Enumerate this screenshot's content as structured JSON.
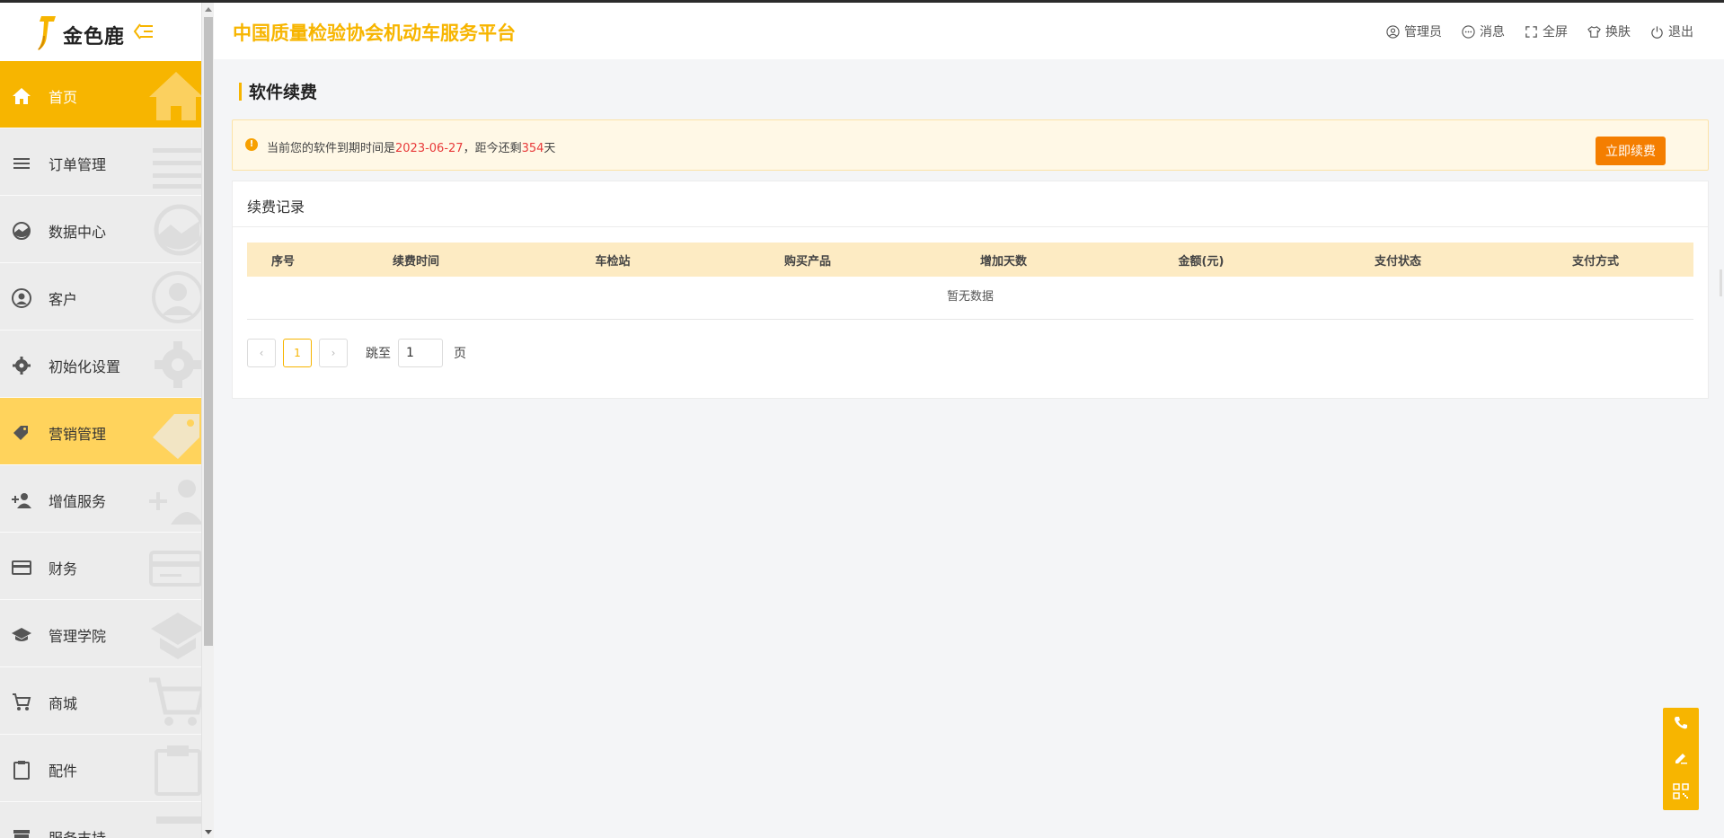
{
  "brand": {
    "logo_text": "金色鹿"
  },
  "app_title": "中国质量检验协会机动车服务平台",
  "header_actions": [
    {
      "label": "管理员",
      "icon": "user-circle-icon"
    },
    {
      "label": "消息",
      "icon": "message-icon"
    },
    {
      "label": "全屏",
      "icon": "fullscreen-icon"
    },
    {
      "label": "换肤",
      "icon": "shirt-icon"
    },
    {
      "label": "退出",
      "icon": "power-icon"
    }
  ],
  "sidebar": {
    "items": [
      {
        "label": "首页",
        "icon": "home-icon",
        "state": "active"
      },
      {
        "label": "订单管理",
        "icon": "list-icon"
      },
      {
        "label": "数据中心",
        "icon": "chart-icon"
      },
      {
        "label": "客户",
        "icon": "user-icon"
      },
      {
        "label": "初始化设置",
        "icon": "gear-icon"
      },
      {
        "label": "营销管理",
        "icon": "tag-icon",
        "state": "highlight"
      },
      {
        "label": "增值服务",
        "icon": "add-user-icon"
      },
      {
        "label": "财务",
        "icon": "card-icon"
      },
      {
        "label": "管理学院",
        "icon": "graduation-cap-icon"
      },
      {
        "label": "商城",
        "icon": "cart-icon"
      },
      {
        "label": "配件",
        "icon": "clipboard-icon"
      },
      {
        "label": "服务支持",
        "icon": "archive-icon"
      }
    ]
  },
  "page": {
    "title": "软件续费",
    "notice": {
      "prefix": "当前您的软件到期时间是",
      "expiry_date": "2023-06-27",
      "middle": "，距今还剩",
      "days_left": "354",
      "suffix": "天",
      "button": "立即续费"
    },
    "records": {
      "title": "续费记录",
      "columns": [
        "序号",
        "续费时间",
        "车检站",
        "购买产品",
        "增加天数",
        "金额(元)",
        "支付状态",
        "支付方式"
      ],
      "empty_text": "暂无数据"
    },
    "pagination": {
      "current_page": "1",
      "prev": "‹",
      "next": "›",
      "jump_label": "跳至",
      "jump_value": "1",
      "unit": "页"
    }
  },
  "colors": {
    "accent": "#f7b500",
    "button": "#f47e00",
    "highlight": "#ffd35c",
    "danger": "#e83a3a"
  },
  "float_tools": [
    "phone-icon",
    "edit-icon",
    "qrcode-icon"
  ]
}
